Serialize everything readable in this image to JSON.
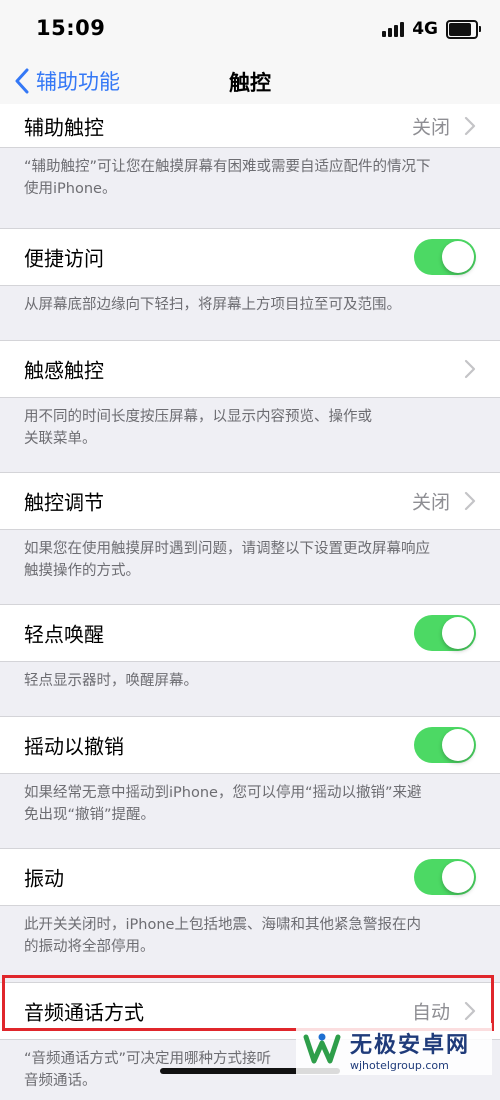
{
  "status_bar": {
    "time": "15:09",
    "network": "4G"
  },
  "nav": {
    "back_label": "辅助功能",
    "title": "触控"
  },
  "rows": [
    {
      "label": "辅助触控",
      "value": "关闭",
      "control": "chevron"
    },
    {
      "label": "便捷访问",
      "control": "toggle",
      "on": true
    },
    {
      "label": "触感触控",
      "control": "chevron"
    },
    {
      "label": "触控调节",
      "value": "关闭",
      "control": "chevron"
    },
    {
      "label": "轻点唤醒",
      "control": "toggle",
      "on": true
    },
    {
      "label": "摇动以撤销",
      "control": "toggle",
      "on": true
    },
    {
      "label": "振动",
      "control": "toggle",
      "on": true
    },
    {
      "label": "音频通话方式",
      "value": "自动",
      "control": "chevron",
      "highlighted": true
    }
  ],
  "footers": [
    "“辅助触控”可让您在触摸屏幕有困难或需要自适应配件的情况下\n使用iPhone。",
    "从屏幕底部边缘向下轻扫，将屏幕上方项目拉至可及范围。",
    "用不同的时间长度按压屏幕，以显示内容预览、操作或\n关联菜单。",
    "如果您在使用触摸屏时遇到问题，请调整以下设置更改屏幕响应\n触摸操作的方式。",
    "轻点显示器时，唤醒屏幕。",
    "如果经常无意中摇动到iPhone，您可以停用“摇动以撤销”来避\n免出现“撤销”提醒。",
    "此开关关闭时，iPhone上包括地震、海啸和其他紧急警报在内\n的振动将全部停用。",
    "“音频通话方式”可决定用哪种方式接听\n音频通话。"
  ],
  "colors": {
    "accent": "#3478f6",
    "toggle_on": "#4cd964",
    "highlight": "#e0262b",
    "background": "#efeff4"
  },
  "watermark": {
    "name": "无极安卓网",
    "url": "wjhotelgroup.com"
  }
}
